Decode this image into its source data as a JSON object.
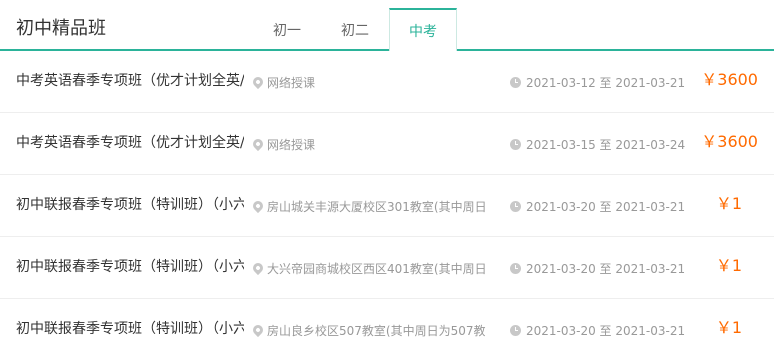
{
  "header": {
    "title": "初中精品班",
    "tabs": [
      {
        "label": "初一",
        "active": false
      },
      {
        "label": "初二",
        "active": false
      },
      {
        "label": "中考",
        "active": true
      }
    ]
  },
  "colors": {
    "accent": "#2bb39a",
    "price": "#ff6a00",
    "muted_text": "#999999"
  },
  "courses": [
    {
      "title": "中考英语春季专项班（优才计划全英/听",
      "location": "网络授课",
      "date_range": "2021-03-12 至 2021-03-21",
      "price": "￥3600",
      "location_icon": "location-pin-icon",
      "time_icon": "clock-icon"
    },
    {
      "title": "中考英语春季专项班（优才计划全英/听",
      "location": "网络授课",
      "date_range": "2021-03-15 至 2021-03-24",
      "price": "￥3600",
      "location_icon": "location-pin-icon",
      "time_icon": "clock-icon"
    },
    {
      "title": "初中联报春季专项班（特训班）（小六",
      "location": "房山城关丰源大厦校区301教室(其中周日",
      "date_range": "2021-03-20 至 2021-03-21",
      "price": "￥1",
      "location_icon": "location-pin-icon",
      "time_icon": "clock-icon"
    },
    {
      "title": "初中联报春季专项班（特训班）（小六",
      "location": "大兴帝园商城校区西区401教室(其中周日",
      "date_range": "2021-03-20 至 2021-03-21",
      "price": "￥1",
      "location_icon": "location-pin-icon",
      "time_icon": "clock-icon"
    },
    {
      "title": "初中联报春季专项班（特训班）（小六",
      "location": "房山良乡校区507教室(其中周日为507教",
      "date_range": "2021-03-20 至 2021-03-21",
      "price": "￥1",
      "location_icon": "location-pin-icon",
      "time_icon": "clock-icon"
    }
  ]
}
